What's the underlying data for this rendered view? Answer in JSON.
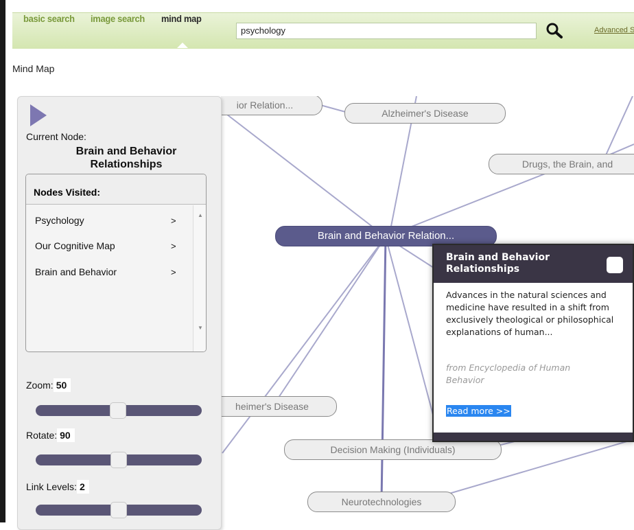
{
  "nav": {
    "basic": "basic search",
    "image": "image search",
    "mindmap": "mind map"
  },
  "search": {
    "value": "psychology"
  },
  "advanced_link": "Advanced S",
  "page_title": "Mind Map",
  "panel": {
    "current_label": "Current Node:",
    "current_name": "Brain and Behavior Relationships",
    "visited_header": "Nodes Visited:",
    "visited": [
      {
        "label": "Psychology",
        "arrow": ">"
      },
      {
        "label": "Our Cognitive Map",
        "arrow": ">"
      },
      {
        "label": "Brain and Behavior",
        "arrow": ">"
      }
    ],
    "zoom": {
      "label": "Zoom:",
      "value": "50"
    },
    "rotate": {
      "label": "Rotate:",
      "value": "90"
    },
    "link_levels": {
      "label": "Link Levels:",
      "value": "2"
    }
  },
  "map": {
    "nodes": {
      "top_left": "ior Relation...",
      "alzheimers_top": "Alzheimer's Disease",
      "drugs": "Drugs, the Brain, and",
      "current": "Brain and Behavior Relation...",
      "alzheimers_bottom": "heimer's Disease",
      "decision": "Decision Making (Individuals)",
      "neurotech": "Neurotechnologies"
    }
  },
  "popup": {
    "title": "Brain and Behavior Relationships",
    "body": "Advances in the natural sciences and medicine have resulted in a shift from exclusively theological or philosophical explanations of human...",
    "source": "from Encyclopedia of Human Behavior",
    "link": "Read more >>"
  },
  "colors": {
    "accent": "#7d77b1",
    "current_node": "#5b5b8c",
    "popup_header": "#3a3545",
    "slider": "#5a5676"
  }
}
